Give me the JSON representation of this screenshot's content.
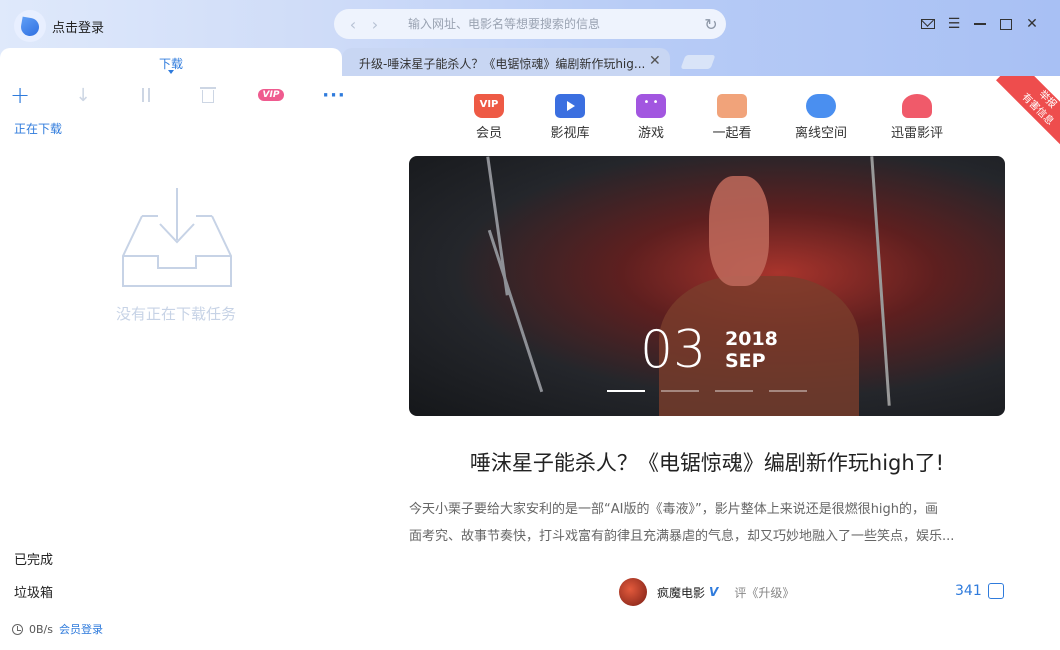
{
  "header": {
    "login_label": "点击登录",
    "address_placeholder": "输入网址、电影名等想要搜索的信息"
  },
  "tabs": {
    "download_label": "下载",
    "article_label": "升级-唾沫星子能杀人？《电锯惊魂》编剧新作玩hig..."
  },
  "toolbar": {
    "vip_label": "VIP",
    "more_label": "···"
  },
  "left_panel": {
    "downloading_label": "正在下载",
    "empty_text": "没有正在下载任务",
    "completed_label": "已完成",
    "trash_label": "垃圾箱",
    "speed": "0B/s",
    "member_login": "会员登录"
  },
  "nav": {
    "items": [
      {
        "label": "会员",
        "icon": "vip-icon"
      },
      {
        "label": "影视库",
        "icon": "video-library-icon"
      },
      {
        "label": "游戏",
        "icon": "game-icon"
      },
      {
        "label": "一起看",
        "icon": "watch-together-icon"
      },
      {
        "label": "离线空间",
        "icon": "cloud-icon"
      },
      {
        "label": "迅雷影评",
        "icon": "review-icon"
      }
    ],
    "vip_badge": "VIP"
  },
  "ribbon": {
    "line1": "举报",
    "line2": "有害信息"
  },
  "banner": {
    "day": "03",
    "year": "2018",
    "month": "SEP",
    "slide_count": 4,
    "active_slide": 1
  },
  "article": {
    "title": "唾沫星子能杀人？《电锯惊魂》编剧新作玩high了!",
    "excerpt_line1": "今天小栗子要给大家安利的是一部“AI版的《毒液》”，影片整体上来说还是很燃很high的，画",
    "excerpt_line2": "面考究、故事节奏快，打斗戏富有韵律且充满暴虐的气息，却又巧妙地融入了一些笑点，娱乐...",
    "author": "疯魔电影",
    "verified_mark": "V",
    "review_of": "评《升级》",
    "likes": "341"
  },
  "colors": {
    "accent": "#2f7bdc",
    "vip_pink": "#ef5b8f",
    "ribbon_red": "#ee4d4d"
  }
}
